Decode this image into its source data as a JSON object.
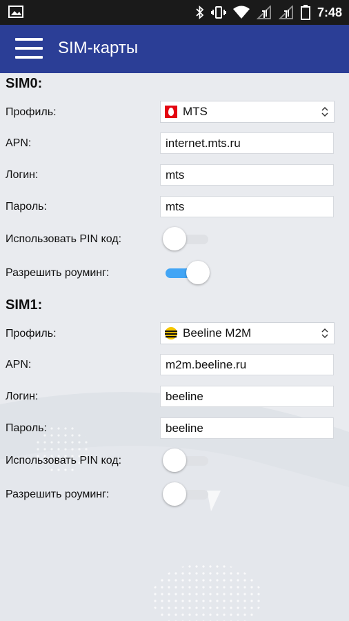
{
  "status_bar": {
    "time": "7:48",
    "icons": [
      "image-icon",
      "bluetooth-icon",
      "vibrate-icon",
      "wifi-icon",
      "signal-icon",
      "signal-icon",
      "battery-icon"
    ]
  },
  "app_bar": {
    "title": "SIM-карты",
    "menu_icon": "menu-icon"
  },
  "sim0": {
    "title": "SIM0:",
    "profile": {
      "label": "Профиль:",
      "value": "MTS",
      "logo": "mts-logo"
    },
    "apn": {
      "label": "APN:",
      "value": "internet.mts.ru"
    },
    "login": {
      "label": "Логин:",
      "value": "mts"
    },
    "password": {
      "label": "Пароль:",
      "value": "mts"
    },
    "use_pin": {
      "label": "Использовать PIN код:",
      "on": false
    },
    "roaming": {
      "label": "Разрешить роуминг:",
      "on": true
    }
  },
  "sim1": {
    "title": "SIM1:",
    "profile": {
      "label": "Профиль:",
      "value": "Beeline M2M",
      "logo": "beeline-logo"
    },
    "apn": {
      "label": "APN:",
      "value": "m2m.beeline.ru"
    },
    "login": {
      "label": "Логин:",
      "value": "beeline"
    },
    "password": {
      "label": "Пароль:",
      "value": "beeline"
    },
    "use_pin": {
      "label": "Использовать PIN код:",
      "on": false
    },
    "roaming": {
      "label": "Разрешить роуминг:",
      "on": false
    }
  },
  "colors": {
    "app_bar": "#2b3e96",
    "status_bar": "#1a1a1a",
    "toggle_on": "#42a5f5",
    "background": "#e9ebef"
  }
}
